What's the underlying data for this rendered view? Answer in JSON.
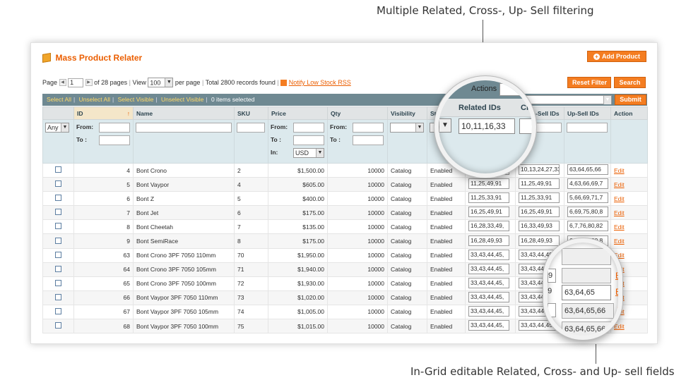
{
  "callouts": {
    "top": "Multiple Related, Cross-, Up- Sell filtering",
    "bottom": "In-Grid editable Related, Cross- and Up- sell fields"
  },
  "page_title": "Mass Product Relater",
  "buttons": {
    "add_product": "Add Product",
    "reset_filter": "Reset Filter",
    "search": "Search",
    "submit": "Submit"
  },
  "pager": {
    "page_label": "Page",
    "page_value": "1",
    "of_pages": "of 28 pages",
    "view_label": "View",
    "view_value": "100",
    "per_page": "per page",
    "records": "Total 2800 records found",
    "rss_link": "Notify Low Stock RSS"
  },
  "massaction": {
    "select_all": "Select All",
    "unselect_all": "Unselect All",
    "select_visible": "Select Visible",
    "unselect_visible": "Unselect Visible",
    "selected": "0 items selected",
    "actions_label": "Actions"
  },
  "columns": [
    "ID",
    "Name",
    "SKU",
    "Price",
    "Qty",
    "Visibility",
    "St",
    "Related IDs",
    "Cross-Sell IDs",
    "Up-Sell IDs",
    "Action"
  ],
  "filters": {
    "any": "Any",
    "from": "From:",
    "to": "To :",
    "in": "In:",
    "currency": "USD",
    "related_value": "10,11,16,33"
  },
  "rows": [
    {
      "id": "4",
      "name": "Bont Crono",
      "sku": "2",
      "price": "$1,500.00",
      "qty": "10000",
      "visibility": "Catalog",
      "status": "Enabled",
      "related": "",
      "cross": "10,13,24,27,33",
      "up": "63,64,65,66",
      "action": "Edit"
    },
    {
      "id": "5",
      "name": "Bont Vaypor",
      "sku": "4",
      "price": "$605.00",
      "qty": "10000",
      "visibility": "Catalog",
      "status": "Enabled",
      "related": "11,25,49,91",
      "cross": "11,25,49,91",
      "up": "4,63,66,69,7",
      "action": "Edit"
    },
    {
      "id": "6",
      "name": "Bont Z",
      "sku": "5",
      "price": "$400.00",
      "qty": "10000",
      "visibility": "Catalog",
      "status": "Enabled",
      "related": "11,25,33,91",
      "cross": "11,25,33,91",
      "up": "5,66,69,71,7",
      "action": "Edit"
    },
    {
      "id": "7",
      "name": "Bont Jet",
      "sku": "6",
      "price": "$175.00",
      "qty": "10000",
      "visibility": "Catalog",
      "status": "Enabled",
      "related": "16,25,49,91",
      "cross": "16,25,49,91",
      "up": "6,69,75,80,8",
      "action": "Edit"
    },
    {
      "id": "8",
      "name": "Bont Cheetah",
      "sku": "7",
      "price": "$135.00",
      "qty": "10000",
      "visibility": "Catalog",
      "status": "Enabled",
      "related": "16,28,33,49,",
      "cross": "16,33,49,93",
      "up": "6,7,76,80,82",
      "action": "Edit"
    },
    {
      "id": "9",
      "name": "Bont SemiRace",
      "sku": "8",
      "price": "$175.00",
      "qty": "10000",
      "visibility": "Catalog",
      "status": "Enabled",
      "related": "16,28,49,93",
      "cross": "16,28,49,93",
      "up": "6,77,79,80,8",
      "action": "Edit"
    },
    {
      "id": "63",
      "name": "Bont Crono 3PF 7050 110mm",
      "sku": "70",
      "price": "$1,950.00",
      "qty": "10000",
      "visibility": "Catalog",
      "status": "Enabled",
      "related": "33,43,44,45,",
      "cross": "33,43,44,49",
      "up": "",
      "action": "Edit"
    },
    {
      "id": "64",
      "name": "Bont Crono 3PF 7050 105mm",
      "sku": "71",
      "price": "$1,940.00",
      "qty": "10000",
      "visibility": "Catalog",
      "status": "Enabled",
      "related": "33,43,44,45,",
      "cross": "33,43,44,49",
      "up": "",
      "action": "Edit"
    },
    {
      "id": "65",
      "name": "Bont Crono 3PF 7050 100mm",
      "sku": "72",
      "price": "$1,930.00",
      "qty": "10000",
      "visibility": "Catalog",
      "status": "Enabled",
      "related": "33,43,44,45,",
      "cross": "33,43,44,49",
      "up": "63,64,65",
      "action": "Edit"
    },
    {
      "id": "66",
      "name": "Bont Vaypor 3PF 7050 110mm",
      "sku": "73",
      "price": "$1,020.00",
      "qty": "10000",
      "visibility": "Catalog",
      "status": "Enabled",
      "related": "33,43,44,45,",
      "cross": "33,43,44,49",
      "up": "63,64,65,66",
      "action": "Edit"
    },
    {
      "id": "67",
      "name": "Bont Vaypor 3PF 7050 105mm",
      "sku": "74",
      "price": "$1,005.00",
      "qty": "10000",
      "visibility": "Catalog",
      "status": "Enabled",
      "related": "33,43,44,45,",
      "cross": "33,43,44,49",
      "up": "63,64,65,66",
      "action": "Edit"
    },
    {
      "id": "68",
      "name": "Bont Vaypor 3PF 7050 100mm",
      "sku": "75",
      "price": "$1,015.00",
      "qty": "10000",
      "visibility": "Catalog",
      "status": "Enabled",
      "related": "33,43,44,45,",
      "cross": "33,43,44,45,",
      "up": "63,64,65,66",
      "action": "Edit"
    }
  ]
}
